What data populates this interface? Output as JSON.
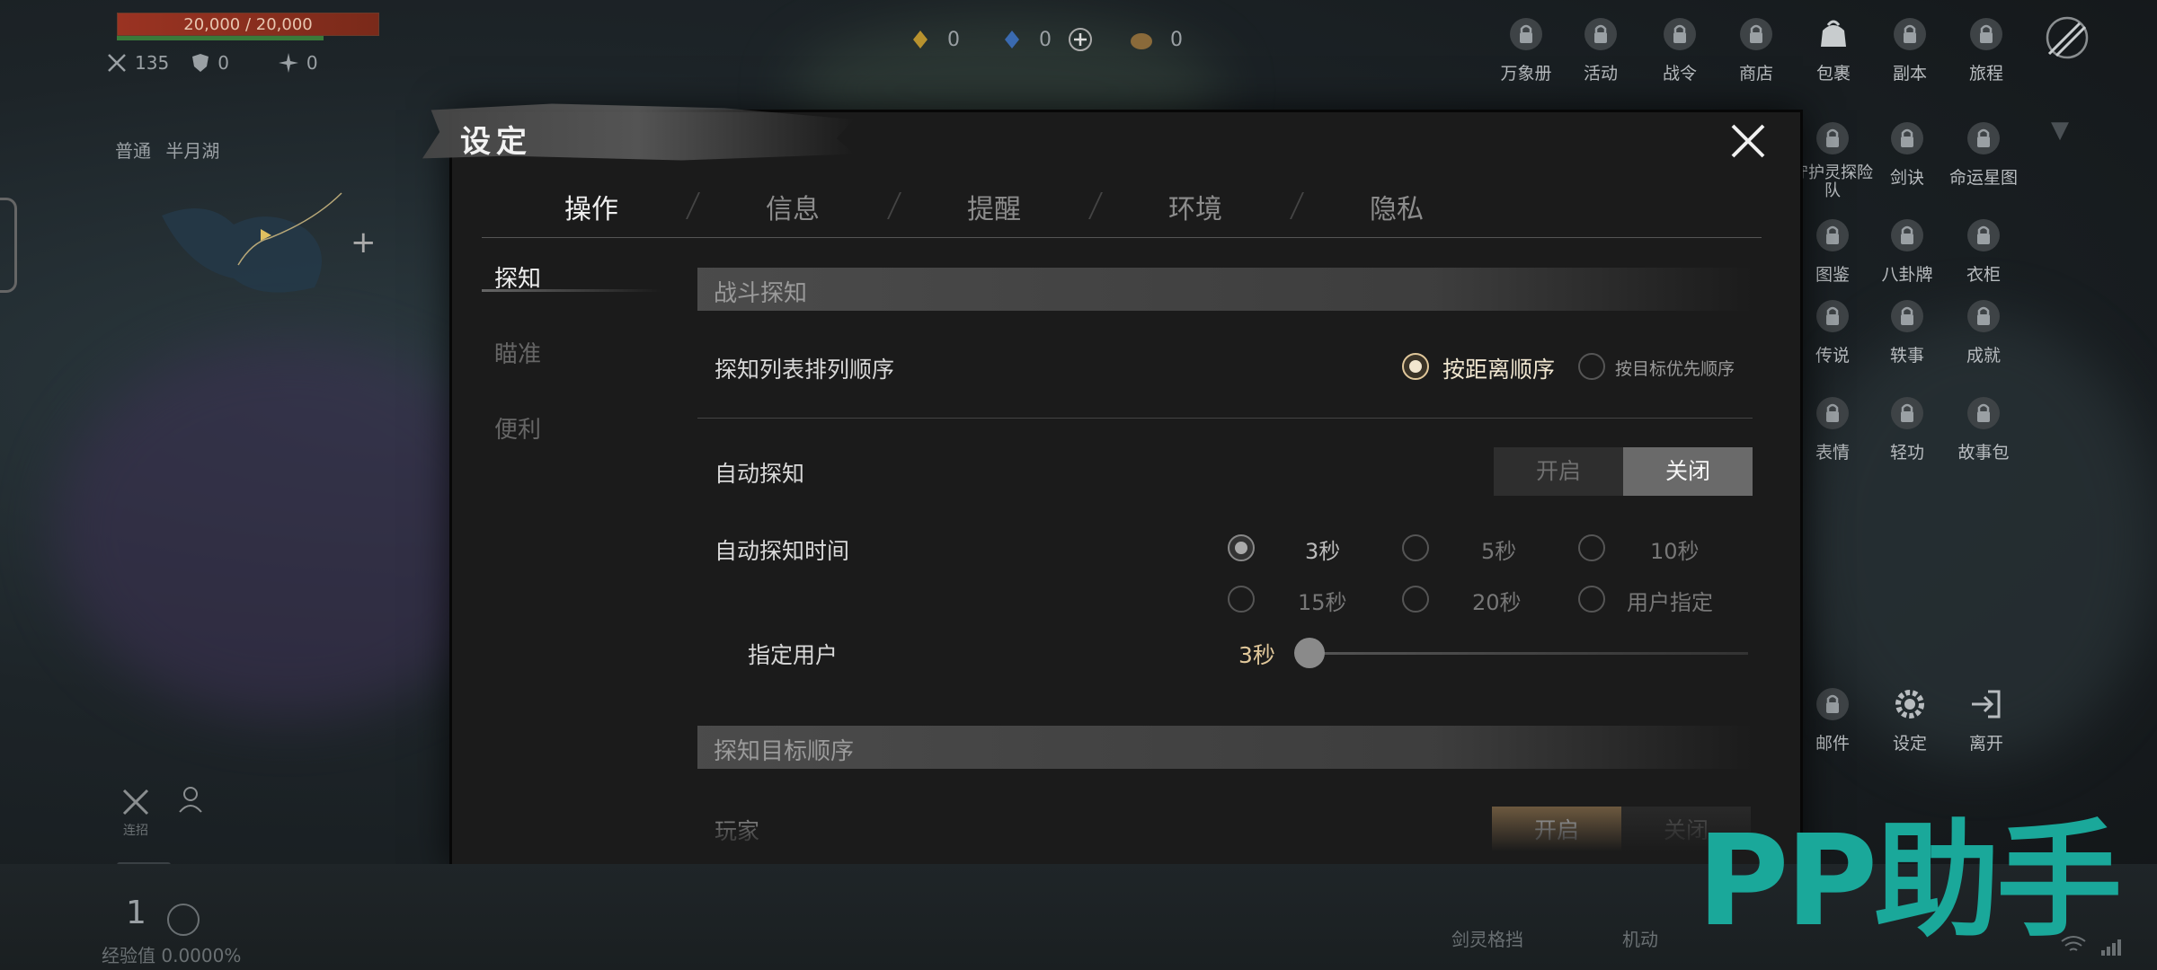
{
  "hud": {
    "hp_text": "20,000 / 20,000",
    "stats": [
      {
        "icon": "crossed-swords-icon",
        "value": "135"
      },
      {
        "icon": "shield-icon",
        "value": "0"
      },
      {
        "icon": "sparkle-icon",
        "value": "0"
      }
    ],
    "currency": [
      {
        "icon": "gold-gem-icon",
        "value": "0"
      },
      {
        "icon": "blue-gem-icon",
        "value": "0"
      },
      {
        "icon": "coin-bag-icon",
        "value": "0"
      }
    ],
    "location_mode": "普通",
    "location_name": "半月湖",
    "exp_label": "经验值 0.0000%",
    "level": "1",
    "skill_label": "连招",
    "bottom_labels": [
      "剑灵格挡",
      "机动"
    ]
  },
  "right_menu": {
    "top_row": [
      "万象册",
      "活动",
      "战令",
      "商店",
      "包裹",
      "副本",
      "旅程"
    ],
    "row2": [
      "守护灵探险队",
      "剑诀",
      "命运星图"
    ],
    "row3": [
      "图鉴",
      "八卦牌",
      "衣柜"
    ],
    "row4": [
      "传说",
      "轶事",
      "成就"
    ],
    "row5": [
      "表情",
      "轻功",
      "故事包"
    ],
    "row6": [
      "邮件",
      "设定",
      "离开"
    ]
  },
  "dialog": {
    "title": "设定",
    "tabs": [
      "操作",
      "信息",
      "提醒",
      "环境",
      "隐私"
    ],
    "active_tab": "操作",
    "side_items": [
      "探知",
      "瞄准",
      "便利"
    ],
    "active_side": "探知",
    "section1": "战斗探知",
    "list_order_label": "探知列表排列顺序",
    "list_order_opts": [
      "按距离顺序",
      "按目标优先顺序"
    ],
    "auto_detect_label": "自动探知",
    "toggle_on": "开启",
    "toggle_off": "关闭",
    "auto_time_label": "自动探知时间",
    "time_opts": [
      "3秒",
      "5秒",
      "10秒",
      "15秒",
      "20秒",
      "用户指定"
    ],
    "user_label": "指定用户",
    "user_value": "3秒",
    "section2": "探知目标顺序",
    "player_label": "玩家"
  },
  "watermark": "PP助手",
  "colors": {
    "accent_gold": "#e0c79a",
    "watermark": "#1aa89a",
    "toggle_gold": "#8a6f4c"
  }
}
